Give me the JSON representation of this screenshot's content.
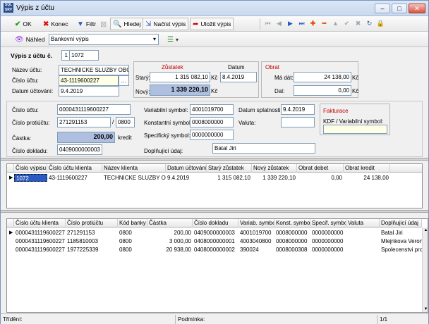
{
  "window": {
    "title": "Výpis z účtu",
    "app_badge": "SQL\nSRV"
  },
  "toolbar1": {
    "ok": "OK",
    "konec": "Konec",
    "filtr": "Filtr",
    "hledej": "Hledej",
    "nacist": "Načíst výpis",
    "ulozit": "Uložit výpis"
  },
  "toolbar2": {
    "nahled": "Náhled",
    "report": "Bankovní výpis"
  },
  "header": {
    "vypis_label": "Výpis z účtu č.",
    "vypis_no": "1",
    "vypis_year": "1072"
  },
  "account": {
    "nazev_label": "Název účtu:",
    "nazev": "TECHNICKE SLUZBY OBC",
    "cislo_label": "Číslo účtu:",
    "cislo": "43-1119600227",
    "datum_label": "Datum účtování:",
    "datum": "9.4.2019"
  },
  "zustatek": {
    "title": "Zůstatek",
    "datum_title": "Datum",
    "stary_label": "Starý:",
    "stary": "1 315 082,10",
    "stary_cur": "Kč",
    "stary_datum": "8.4.2019",
    "novy_label": "Nový:",
    "novy": "1 339 220,10",
    "novy_cur": "Kč"
  },
  "obrat": {
    "title": "Obrat",
    "ma_dati_label": "Má dát:",
    "ma_dati": "24 138,00",
    "ma_dati_cur": "Kč",
    "dal_label": "Dal:",
    "dal": "0,00",
    "dal_cur": "Kč"
  },
  "detail": {
    "cislo_uctu_label": "Číslo účtu:",
    "cislo_uctu": "0000431119600227",
    "protiucet_label": "Číslo protiúčtu:",
    "protiucet": "271291153",
    "slash": "/",
    "banka": "0800",
    "castka_label": "Částka:",
    "castka": "200,00",
    "castka_suffix": "kredit",
    "doklad_label": "Číslo dokladu:",
    "doklad": "0409000000003",
    "vs_label": "Variabilní symbol:",
    "vs": "4001019700",
    "ks_label": "Konstantní symbol:",
    "ks": "0008000000",
    "ss_label": "Specifický symbol:",
    "ss": "0000000000",
    "doplnujici_label": "Doplňující údaj:",
    "doplnujici": "Batal Jiri",
    "splatnost_label": "Datum splatnosti:",
    "splatnost": "9.4.2019",
    "valuta_label": "Valuta:",
    "valuta": "",
    "fakturace_title": "Fakturace",
    "kdf_label": "KDF / Variabilní symbol:",
    "kdf": ""
  },
  "grid1": {
    "columns": [
      "Číslo výpisu",
      "Číslo účtu klienta",
      "Název klienta",
      "Datum účtování",
      "Starý zůstatek",
      "Nový zůstatek",
      "Obrat debet",
      "Obrat kredit"
    ],
    "rows": [
      [
        "1072",
        "43-1119600227",
        "TECHNICKE SLUZBY OE",
        "9.4.2019",
        "1 315 082,10",
        "1 339 220,10",
        "0,00",
        "24 138,00"
      ]
    ]
  },
  "grid2": {
    "columns": [
      "Číslo účtu klienta",
      "Číslo protiúčtu",
      "Kód banky",
      "Částka",
      "Číslo dokladu",
      "Variab. symbo",
      "Konst. symbol",
      "Specif. symbo",
      "Valuta",
      "Doplňující údaj"
    ],
    "rows": [
      [
        "0000431119600227",
        "271291153",
        "0800",
        "200,00",
        "0409000000003",
        "4001019700",
        "0008000000",
        "0000000000",
        "",
        "Batal Jiri"
      ],
      [
        "0000431119600227",
        "1185810003",
        "0800",
        "3 000,00",
        "0408000000001",
        "4003040800",
        "0008000000",
        "0000000000",
        "",
        "Mlejnkova Veron"
      ],
      [
        "0000431119600227",
        "1977225339",
        "0800",
        "20 938,00",
        "0408000000002",
        "390024",
        "0008000308",
        "0000000000",
        "",
        "Spolecenstvi pro"
      ]
    ]
  },
  "status": {
    "trideni": "Třídění:",
    "podminka": "Podmínka:",
    "page": "1/1"
  },
  "colors": {
    "accent": "#2b59c3",
    "red": "#c00000",
    "highlight": "#aebfe0"
  }
}
